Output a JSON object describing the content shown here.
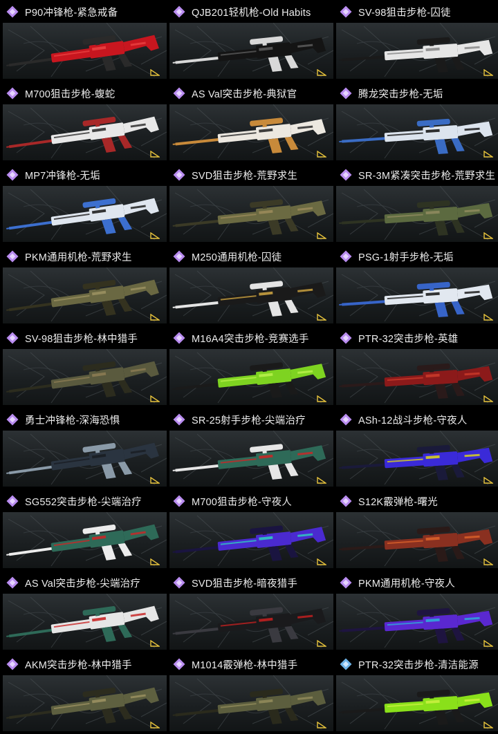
{
  "rarity_colors": {
    "legendary": "#b98cf0",
    "epic": "#6db3e8"
  },
  "accent_badge_color": "#e6c23c",
  "items": [
    {
      "name": "P90冲锋枪-紧急戒备",
      "rarity": "legendary",
      "palette": [
        "#c8161f",
        "#2a2a2a",
        "#e84040"
      ]
    },
    {
      "name": "QJB201轻机枪-Old Habits",
      "rarity": "legendary",
      "palette": [
        "#141414",
        "#d8d8d8",
        "#5a5a5a"
      ]
    },
    {
      "name": "SV-98狙击步枪-囚徒",
      "rarity": "legendary",
      "palette": [
        "#e6e6e6",
        "#1a1a1a",
        "#8a8a8a"
      ]
    },
    {
      "name": "M700狙击步枪-蝮蛇",
      "rarity": "legendary",
      "palette": [
        "#e8e8e8",
        "#a82828",
        "#303030"
      ]
    },
    {
      "name": "AS Val突击步枪-典狱官",
      "rarity": "legendary",
      "palette": [
        "#ece8e0",
        "#c88a3a",
        "#2a2a2a"
      ]
    },
    {
      "name": "腾龙突击步枪-无垢",
      "rarity": "legendary",
      "palette": [
        "#dce4ee",
        "#3a6cc4",
        "#1a1a1a"
      ]
    },
    {
      "name": "MP7冲锋枪-无垢",
      "rarity": "legendary",
      "palette": [
        "#dfe6ef",
        "#3c6fcf",
        "#202020"
      ]
    },
    {
      "name": "SVD狙击步枪-荒野求生",
      "rarity": "legendary",
      "palette": [
        "#6b6a42",
        "#3b3a26",
        "#9a8a5a"
      ]
    },
    {
      "name": "SR-3M紧凑突击步枪-荒野求生",
      "rarity": "legendary",
      "palette": [
        "#5c6a40",
        "#2e3322",
        "#8e8a5e"
      ]
    },
    {
      "name": "PKM通用机枪-荒野求生",
      "rarity": "legendary",
      "palette": [
        "#6a6842",
        "#34321f",
        "#9a9060"
      ]
    },
    {
      "name": "M250通用机枪-囚徒",
      "rarity": "legendary",
      "palette": [
        "#1a1a1a",
        "#e4e4e4",
        "#c8a040"
      ]
    },
    {
      "name": "PSG-1射手步枪-无垢",
      "rarity": "legendary",
      "palette": [
        "#e2e8f0",
        "#3764c8",
        "#1e1e1e"
      ]
    },
    {
      "name": "SV-98狙击步枪-林中猎手",
      "rarity": "legendary",
      "palette": [
        "#5a5a3e",
        "#2c2c1e",
        "#8a7a52"
      ]
    },
    {
      "name": "M16A4突击步枪-竞赛选手",
      "rarity": "legendary",
      "palette": [
        "#7ed321",
        "#1a1a1a",
        "#b6f04a"
      ]
    },
    {
      "name": "PTR-32突击步枪-英雄",
      "rarity": "legendary",
      "palette": [
        "#8c1a1a",
        "#2a1a1a",
        "#c83a2a"
      ]
    },
    {
      "name": "勇士冲锋枪-深海恐惧",
      "rarity": "legendary",
      "palette": [
        "#2a3440",
        "#8a9aa8",
        "#1a1e24"
      ]
    },
    {
      "name": "SR-25射手步枪-尖端治疗",
      "rarity": "legendary",
      "palette": [
        "#2e6a58",
        "#e6e6e6",
        "#c82828"
      ]
    },
    {
      "name": "ASh-12战斗步枪-守夜人",
      "rarity": "legendary",
      "palette": [
        "#3a2ad8",
        "#1a1a3a",
        "#d8d020"
      ]
    },
    {
      "name": "SG552突击步枪-尖端治疗",
      "rarity": "legendary",
      "palette": [
        "#2e6a58",
        "#ececec",
        "#c82828"
      ]
    },
    {
      "name": "M700狙击步枪-守夜人",
      "rarity": "legendary",
      "palette": [
        "#4a2ad0",
        "#1a1440",
        "#30c8c0"
      ]
    },
    {
      "name": "S12K霰弹枪-曙光",
      "rarity": "legendary",
      "palette": [
        "#8a3020",
        "#2a1a18",
        "#d8602a"
      ]
    },
    {
      "name": "AS Val突击步枪-尖端治疗",
      "rarity": "legendary",
      "palette": [
        "#e6e6e6",
        "#2e6a58",
        "#c82828"
      ]
    },
    {
      "name": "SVD狙击步枪-暗夜猎手",
      "rarity": "legendary",
      "palette": [
        "#1a1a1c",
        "#3a3a40",
        "#c02020"
      ]
    },
    {
      "name": "PKM通用机枪-守夜人",
      "rarity": "legendary",
      "palette": [
        "#5a28d0",
        "#1e1440",
        "#30a8d8"
      ]
    },
    {
      "name": "AKM突击步枪-林中猎手",
      "rarity": "legendary",
      "palette": [
        "#5e6040",
        "#2c2c1e",
        "#9a9060"
      ]
    },
    {
      "name": "M1014霰弹枪-林中猎手",
      "rarity": "legendary",
      "palette": [
        "#5c5e3e",
        "#2a2a1c",
        "#908a5a"
      ]
    },
    {
      "name": "PTR-32突击步枪-清洁能源",
      "rarity": "epic",
      "palette": [
        "#8ae01a",
        "#1a1a1a",
        "#c8f040"
      ]
    }
  ]
}
